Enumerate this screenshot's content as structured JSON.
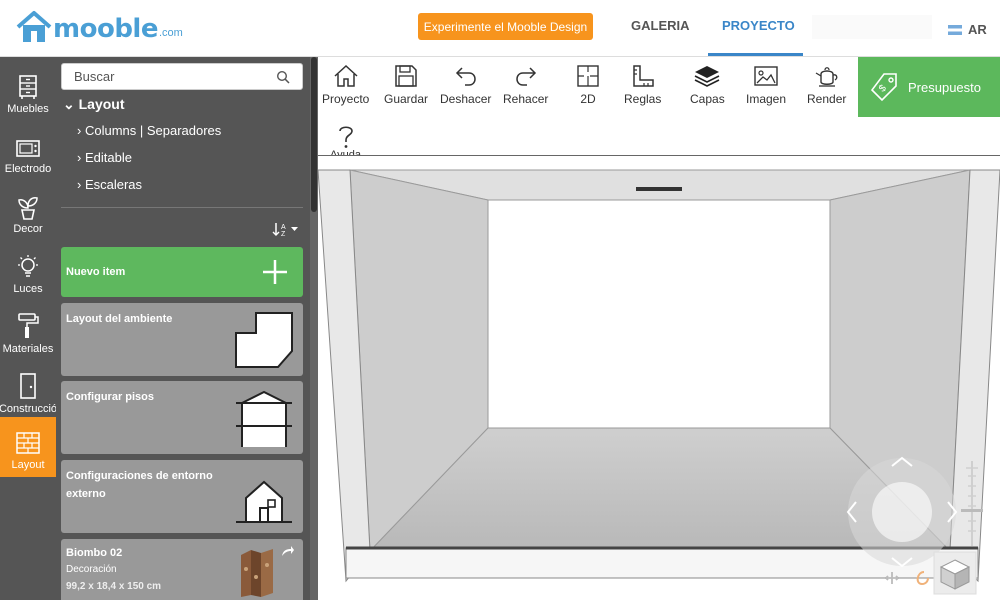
{
  "header": {
    "logo_text": "mooble",
    "logo_tld": ".com",
    "promo_label": "Experimente el Mooble Design",
    "nav": [
      "GALERIA",
      "PROYECTO"
    ],
    "active_nav": "PROYECTO",
    "country": "AR",
    "brand_color": "#4a9fd5",
    "accent_color": "#f7941d"
  },
  "rail": {
    "items": [
      {
        "label": "Muebles",
        "icon": "furniture-icon"
      },
      {
        "label": "Electrodo",
        "icon": "microwave-icon"
      },
      {
        "label": "Decor",
        "icon": "plant-icon"
      },
      {
        "label": "Luces",
        "icon": "lightbulb-icon"
      },
      {
        "label": "Materiales",
        "icon": "paint-roller-icon"
      },
      {
        "label": "Construcció",
        "icon": "door-icon"
      },
      {
        "label": "Layout",
        "icon": "brick-wall-icon"
      }
    ],
    "active": "Layout"
  },
  "catalog": {
    "search_placeholder": "Buscar",
    "tree_root": "Layout",
    "tree_items": [
      "Columns | Separadores",
      "Editable",
      "Escaleras"
    ],
    "cards": {
      "new_item": "Nuevo item",
      "layout_room": "Layout del ambiente",
      "floors": "Configurar pisos",
      "environment": "Configuraciones de entorno externo",
      "product_name": "Biombo 02",
      "product_category": "Decoración",
      "product_dims": "99,2 x 18,4 x 150 cm"
    }
  },
  "toolbar": {
    "tools": [
      {
        "label": "Proyecto",
        "icon": "home-icon"
      },
      {
        "label": "Guardar",
        "icon": "save-icon"
      },
      {
        "label": "Deshacer",
        "icon": "undo-icon"
      },
      {
        "label": "Rehacer",
        "icon": "redo-icon"
      },
      {
        "label": "2D",
        "icon": "floorplan-icon"
      },
      {
        "label": "Reglas",
        "icon": "ruler-icon"
      },
      {
        "label": "Capas",
        "icon": "layers-icon"
      },
      {
        "label": "Imagen",
        "icon": "image-icon"
      },
      {
        "label": "Render",
        "icon": "teapot-icon"
      }
    ],
    "budget_label": "Presupuesto",
    "budget_color": "#5cb85c",
    "help_label": "Ayuda"
  }
}
